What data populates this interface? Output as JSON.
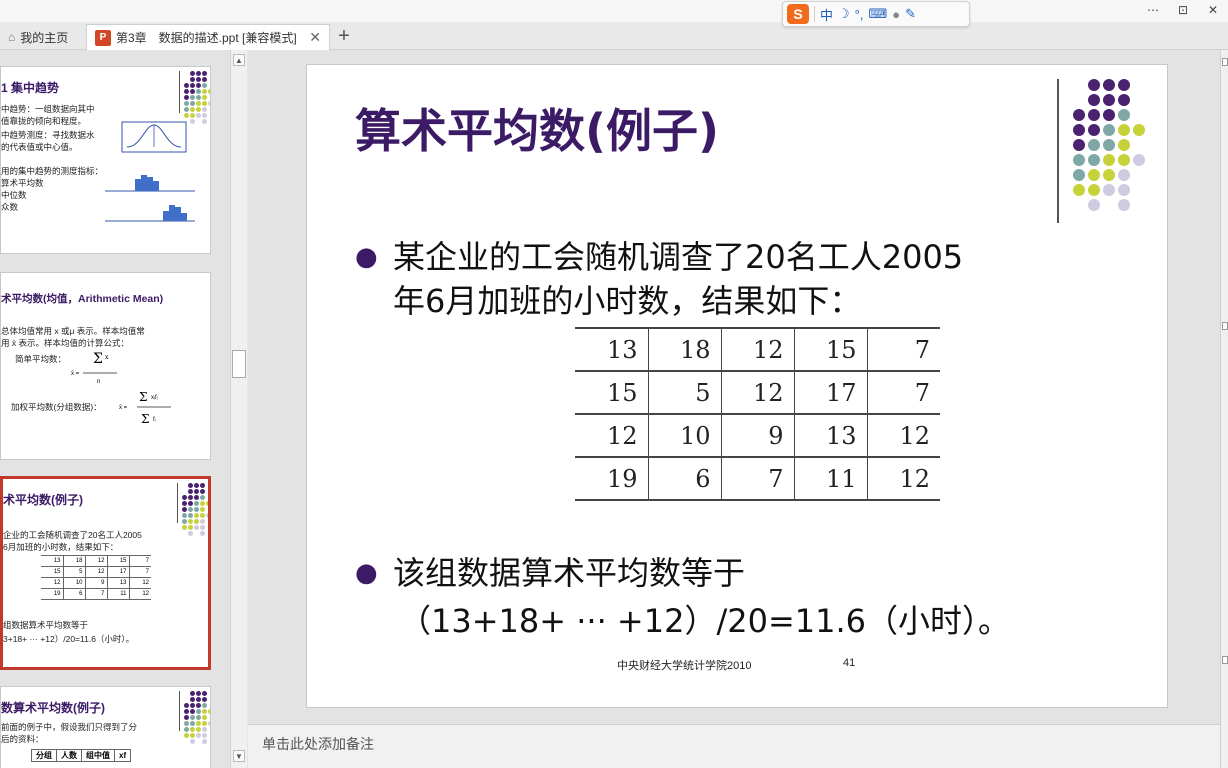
{
  "window": {
    "buttons": [
      "⋯",
      "⊡",
      "✕"
    ]
  },
  "ime": {
    "logo": "S",
    "mode": "中",
    "icons": [
      "moon-icon",
      "punctuation-icon",
      "keyboard-icon",
      "user-icon",
      "wrench-icon"
    ]
  },
  "tabs": {
    "home_label": "我的主页",
    "doc_label": "第3章　数据的描述.ppt [兼容模式]",
    "doc_icon": "P"
  },
  "thumbnails": {
    "t1": {
      "title": "1 集中趋势",
      "lines": [
        "中趋势：一组数据向其中",
        "值靠拢的倾向和程度。",
        "中趋势测度：寻找数据水",
        "的代表值或中心值。",
        "用的集中趋势的测度指标：",
        "算术平均数",
        "中位数",
        "众数"
      ]
    },
    "t2": {
      "title": "术平均数(均值，Arithmetic Mean)",
      "lines": [
        "总体均值常用  x 或μ  表示。样本均值常",
        "用  x̄  表示。样本均值的计算公式：",
        "简单平均数：",
        "加权平均数(分组数据)："
      ]
    },
    "t3": {
      "title": "术平均数(例子)",
      "lines": [
        "企业的工会随机调查了20名工人2005",
        "6月加班的小时数，结果如下：",
        "组数据算术平均数等于",
        "3+18+ ··· +12）/20=11.6（小时）。"
      ]
    },
    "t4": {
      "title": "数算术平均数(例子)",
      "lines": [
        "前面的例子中，假设我们只得到了分",
        "后的资料："
      ],
      "headers": [
        "分组",
        "人数",
        "组中值",
        "xf"
      ]
    }
  },
  "slide": {
    "title": "算术平均数(例子)",
    "bullet1_line1": "某企业的工会随机调查了20名工人2005",
    "bullet1_line2": "年6月加班的小时数，结果如下：",
    "bullet_marker": "●",
    "table": [
      [
        "13",
        "18",
        "12",
        "15",
        "7"
      ],
      [
        "15",
        "5",
        "12",
        "17",
        "7"
      ],
      [
        "12",
        "10",
        "9",
        "13",
        "12"
      ],
      [
        "19",
        "6",
        "7",
        "11",
        "12"
      ]
    ],
    "bullet2_line1": "该组数据算术平均数等于",
    "bullet2_line2": "（13+18+ ··· +12）/20=11.6（小时）。",
    "footer": "中央财经大学统计学院2010",
    "page": "41"
  },
  "notes": {
    "placeholder": "单击此处添加备注"
  },
  "colors": {
    "title": "#3b1a66",
    "dot_purple": "#4a2270",
    "dot_teal": "#7fa7a5",
    "dot_lime": "#c6d23a",
    "dot_lavender": "#cfcbe0",
    "selected_border": "#c0392b"
  }
}
